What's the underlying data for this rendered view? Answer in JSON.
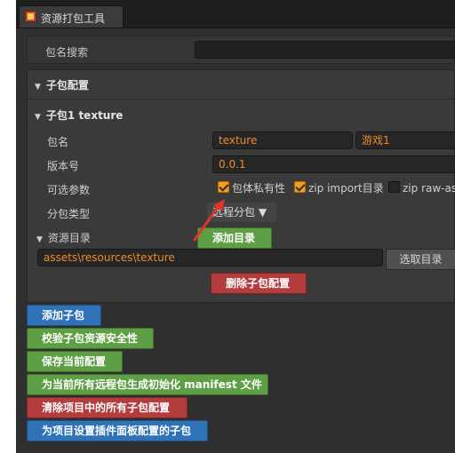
{
  "window": {
    "tab_title": "资源打包工具",
    "tab_icon": "app-icon"
  },
  "search": {
    "label": "包名搜索",
    "value": ""
  },
  "sections": {
    "subpackage_config": "子包配置",
    "subpackage_1": "子包1 texture"
  },
  "fields": {
    "package_name_label": "包名",
    "package_name_value": "texture",
    "display_name_value": "游戏1",
    "version_label": "版本号",
    "version_value": "0.0.1",
    "options_label": "可选参数",
    "options": [
      {
        "label": "包体私有性",
        "checked": true
      },
      {
        "label": "zip import目录",
        "checked": true
      },
      {
        "label": "zip raw-assets目",
        "checked": false
      }
    ],
    "type_label": "分包类型",
    "type_value": "远程分包 ▼",
    "resource_dir_label": "资源目录",
    "add_dir_button": "添加目录",
    "resource_path": "assets\\resources\\texture",
    "choose_dir_button": "选取目录",
    "delete_button": "删除子包配置"
  },
  "actions": [
    {
      "label": "添加子包",
      "color": "blue"
    },
    {
      "label": "校验子包资源安全性",
      "color": "green"
    },
    {
      "label": "保存当前配置",
      "color": "green"
    },
    {
      "label": "为当前所有远程包生成初始化 manifest 文件",
      "color": "green"
    },
    {
      "label": "清除项目中的所有子包配置",
      "color": "red"
    },
    {
      "label": "为项目设置插件面板配置的子包",
      "color": "blue"
    }
  ],
  "colors": {
    "accent_orange": "#f08a24",
    "annotation_red": "#e0342b",
    "green": "#5e9e45",
    "red": "#b33c3d",
    "blue": "#2f72b8"
  }
}
